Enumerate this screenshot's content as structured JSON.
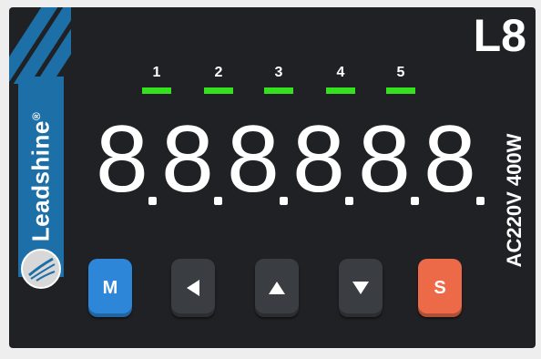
{
  "device": {
    "brand": "Leadshine",
    "brand_mark": "®",
    "model": "L8",
    "rating": "AC220V  400W"
  },
  "indicators": [
    {
      "label": "1",
      "state": "on"
    },
    {
      "label": "2",
      "state": "on"
    },
    {
      "label": "3",
      "state": "on"
    },
    {
      "label": "4",
      "state": "on"
    },
    {
      "label": "5",
      "state": "on"
    }
  ],
  "display": {
    "digits": [
      "8",
      "8",
      "8",
      "8",
      "8",
      "8"
    ],
    "decimal_points": [
      true,
      true,
      true,
      true,
      true,
      true
    ]
  },
  "buttons": {
    "m_label": "M",
    "s_label": "S",
    "left_icon": "left-arrow-icon",
    "up_icon": "up-arrow-icon",
    "down_icon": "down-arrow-icon"
  },
  "colors": {
    "panel": "#1f2124",
    "brand_blue": "#1d6fa8",
    "led_green": "#35e11f",
    "m_button": "#2e86d8",
    "s_button": "#ec6a48",
    "dark_button": "#3a3d41"
  }
}
